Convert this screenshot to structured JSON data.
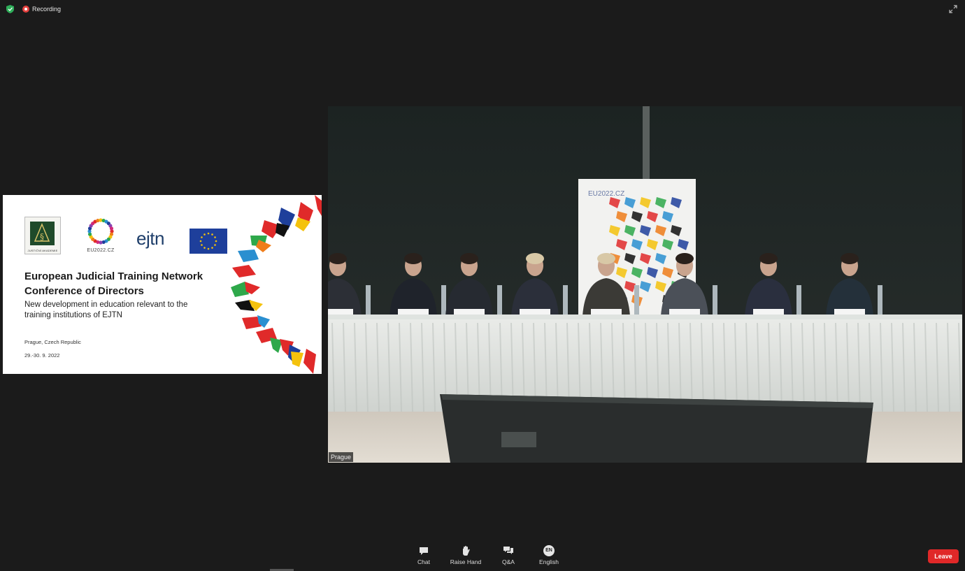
{
  "topbar": {
    "recording_label": "Recording"
  },
  "slide": {
    "logos": {
      "academy_caption": "JUSTIČNÍ AKADEMIE",
      "presidency_caption": "EU2022.CZ",
      "network_wordmark": "ejtn"
    },
    "title_line1": "European Judicial Training Network",
    "title_line2": "Conference of Directors",
    "subtitle_line1": "New development in education relevant to the",
    "subtitle_line2": "training institutions of EJTN",
    "place": "Prague, Czech Republic",
    "dates": "29.-30. 9. 2022"
  },
  "video": {
    "label": "Prague",
    "banner_text": "EU2022.CZ"
  },
  "toolbar": {
    "chat": "Chat",
    "raise_hand": "Raise Hand",
    "qa": "Q&A",
    "language_badge": "EN",
    "language": "English",
    "leave": "Leave"
  },
  "colors": {
    "background": "#1b1b1b",
    "leave_button": "#e02828",
    "recording_dot": "#e5413f",
    "shield": "#2fae5a"
  },
  "icons": [
    "shield-icon",
    "recording-icon",
    "expand-icon",
    "chat-icon",
    "hand-icon",
    "qa-icon"
  ]
}
